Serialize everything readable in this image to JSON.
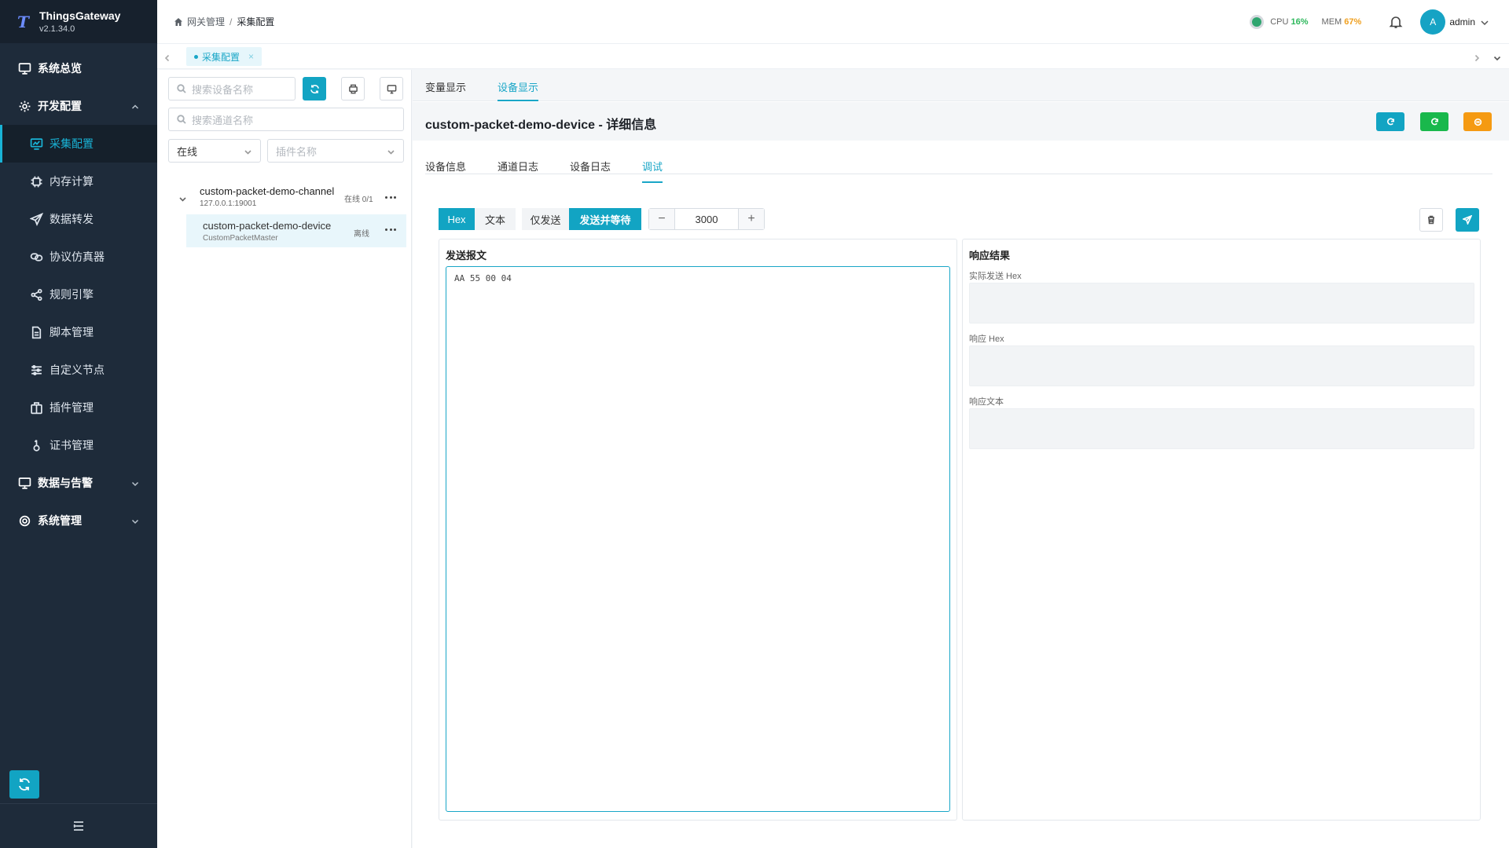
{
  "app": {
    "name": "ThingsGateway",
    "version": "v2.1.34.0"
  },
  "sidebar": {
    "items": [
      {
        "label": "系统总览",
        "icon": "monitor-icon"
      },
      {
        "label": "开发配置",
        "icon": "gear-icon"
      },
      {
        "label": "采集配置",
        "icon": "chart-monitor-icon"
      },
      {
        "label": "内存计算",
        "icon": "chip-icon"
      },
      {
        "label": "数据转发",
        "icon": "send-icon"
      },
      {
        "label": "协议仿真器",
        "icon": "link-icon"
      },
      {
        "label": "规则引擎",
        "icon": "share-icon"
      },
      {
        "label": "脚本管理",
        "icon": "file-icon"
      },
      {
        "label": "自定义节点",
        "icon": "sliders-icon"
      },
      {
        "label": "插件管理",
        "icon": "package-icon"
      },
      {
        "label": "证书管理",
        "icon": "key-icon"
      },
      {
        "label": "数据与告警",
        "icon": "monitor-icon"
      },
      {
        "label": "系统管理",
        "icon": "gear-icon"
      }
    ]
  },
  "header": {
    "breadcrumb": [
      "网关管理",
      "采集配置"
    ],
    "cpu_label": "CPU",
    "cpu_value": "16%",
    "mem_label": "MEM",
    "mem_value": "67%",
    "avatar_letter": "A",
    "username": "admin"
  },
  "open_tab": {
    "label": "采集配置",
    "close": "×"
  },
  "tree_panel": {
    "device_search_placeholder": "搜索设备名称",
    "channel_search_placeholder": "搜索通道名称",
    "status_filter": "在线",
    "plugin_placeholder": "插件名称",
    "channel": {
      "name": "custom-packet-demo-channel",
      "address": "127.0.0.1:19001",
      "status": "在线 0/1"
    },
    "device": {
      "name": "custom-packet-demo-device",
      "plugin": "CustomPacketMaster",
      "status": "离线"
    }
  },
  "main": {
    "view_tabs": [
      "变量显示",
      "设备显示"
    ],
    "detail_title": "custom-packet-demo-device - 详细信息",
    "sub_tabs": [
      "设备信息",
      "通道日志",
      "设备日志",
      "调试"
    ],
    "toolbar": {
      "hex": "Hex",
      "text": "文本",
      "send_only": "仅发送",
      "send_wait": "发送并等待",
      "timeout_value": "3000",
      "minus": "−",
      "plus": "+"
    },
    "send_panel": {
      "title": "发送报文",
      "content": "AA 55 00 04"
    },
    "response_panel": {
      "title": "响应结果",
      "actual_hex_label": "实际发送 Hex",
      "response_hex_label": "响应 Hex",
      "response_text_label": "响应文本"
    }
  },
  "colors": {
    "accent": "#12a4c3",
    "green": "#19b84c",
    "orange": "#f59a12",
    "sidebar_bg": "#1e2b3a"
  }
}
